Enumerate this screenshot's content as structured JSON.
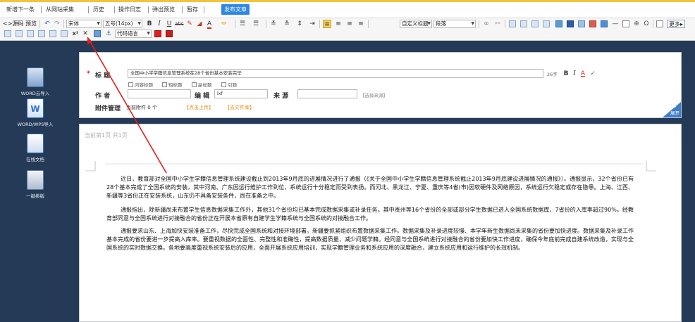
{
  "topbar": {
    "new_next": "新增下一条",
    "from_web": "从网站采集",
    "history": "历史",
    "op_log": "操作日志",
    "popup_preview": "弹出预览",
    "save_draft": "暂存",
    "publish": "发布文章"
  },
  "toolbar": {
    "source_label": "源码",
    "preview_label": "预览",
    "font_family": "宋体",
    "font_size": "五号(14px)",
    "custom_title": "自定义标题",
    "paragraph": "段落",
    "more": "更多",
    "code_lang": "代码语言",
    "superscript": "x²",
    "remove": "✕"
  },
  "sidebar": {
    "items": [
      {
        "label": "WORD云导入",
        "color": "#3b74c4"
      },
      {
        "label": "WORD/WPS导入",
        "color": "#2e6fd0"
      },
      {
        "label": "在线文档",
        "color": "#2d6bc2"
      },
      {
        "label": "一键排版",
        "color": "#5a7ea8"
      }
    ]
  },
  "meta": {
    "required_mark": "*",
    "title_label": "标    题",
    "title_value": "全国中小学学籍信息管理系统在28个省份基本安装完毕",
    "char_count": "26字",
    "options": [
      "内容标题",
      "短标题",
      "副标题",
      "引题"
    ],
    "author_label": "作    者",
    "author_value": "",
    "editor_label": "编  辑",
    "editor_value": "lxf",
    "source_label": "来  源",
    "source_value": "",
    "choose_source": "【选择来源】",
    "attach_label": "附件管理",
    "attach_count": "当前附件 0 个",
    "upload": "【点击上传】",
    "library": "【去文件库】",
    "expand": "展开"
  },
  "doc": {
    "page_info": "当前第1页    共1页",
    "paragraphs": [
      "近日，教育部对全国中小学生学籍信息管理系统建设截止到2013年9月底的进展情况进行了通报（《关于全国中小学生学籍信息管理系统截止2013年9月底建设进展情况的通报》）。通报显示，32个省份已有28个基本完成了全国系统的安装，其中河南、广东因运行维护工作到位，系统运行十分稳定而受到表扬。而河北、黑龙江、宁夏、重庆等4省(市)因软硬件及网络原因，系统运行欠稳定或存在隐患。上海、江西、新疆等3省份正在安装系统，山东仍不具备安装条件，尚在准备之中。",
      "通报指出，除新疆尚未布置学生信息数据采集工作外，其他31个省份均已基本完成数据采集或补录任务。其中贵州等16个省份的全部或部分学生数据已进入全国系统数据库，7省份的入库率超过90%。经教育部同意与全国系统进行对接融合的省份正在开展本省原有自建学生学籍系统与全国系统的对接融合工作。",
      "通报要求山东、上海加快安装准备工作，尽快完成全国系统和对接环境部署。新疆要抓紧组织布置数据采集工作。数据采集及补录进度较慢、本学年新生数据尚未采集的省份要加快进度。数据采集及补录工作基本完成的省份要进一步提高入库率。要重视数据的全面性、完整性和准确性，提高数据质量，减少问题学籍。经同意与全国系统进行对接融合的省份要加快工作进度，确保今年底前完成自建系统改造，实现与全国系统的实时数据交换。各地要高度重视系统安装后的应用，全面开展系统应用培训，实现学籍管理业务和系统应用的深度融合，建立系统应用和运行维护的长效机制。"
    ]
  },
  "colors": {
    "accent": "#2e87e6",
    "arrow": "#e0201a",
    "sidebar_bg": "#243a56",
    "orange": "#e88b1a"
  }
}
